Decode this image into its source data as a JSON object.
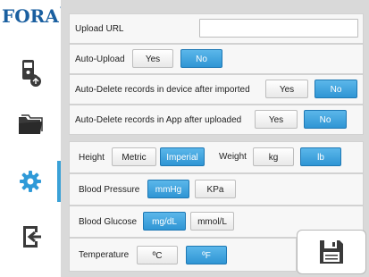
{
  "brand": {
    "logo_text": "FORA"
  },
  "sidebar": {
    "items": [
      {
        "name": "device-sync",
        "icon": "meter-sync-icon"
      },
      {
        "name": "records",
        "icon": "folder-icon"
      },
      {
        "name": "settings",
        "icon": "gear-icon",
        "active": true
      },
      {
        "name": "logout",
        "icon": "logout-icon"
      }
    ],
    "accent": "#3aa1d7"
  },
  "upload": {
    "url_label": "Upload URL",
    "url_value": "",
    "auto_upload_label": "Auto-Upload",
    "auto_upload_yes": "Yes",
    "auto_upload_no": "No",
    "auto_upload_selected": "No"
  },
  "auto_delete_device": {
    "label": "Auto-Delete records in device after imported",
    "yes": "Yes",
    "no": "No",
    "selected": "No"
  },
  "auto_delete_app": {
    "label": "Auto-Delete records in App after uploaded",
    "yes": "Yes",
    "no": "No",
    "selected": "No"
  },
  "units": {
    "height_label": "Height",
    "height_metric": "Metric",
    "height_imperial": "Imperial",
    "height_selected": "Imperial",
    "weight_label": "Weight",
    "weight_kg": "kg",
    "weight_lb": "lb",
    "weight_selected": "lb",
    "bp_label": "Blood Pressure",
    "bp_mmhg": "mmHg",
    "bp_kpa": "KPa",
    "bp_selected": "mmHg",
    "glucose_label": "Blood Glucose",
    "glucose_mgdl": "mg/dL",
    "glucose_mmoll": "mmol/L",
    "glucose_selected": "mg/dL",
    "temp_label": "Temperature",
    "temp_c": "ºC",
    "temp_f": "ºF",
    "temp_selected": "ºF"
  },
  "colors": {
    "selected_button": "#3a9fdc",
    "background": "#d9d9d9",
    "row_background": "#f7f7f7"
  }
}
